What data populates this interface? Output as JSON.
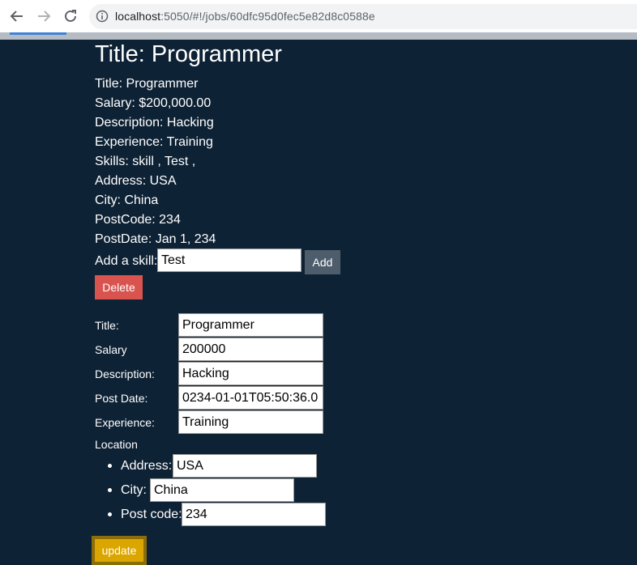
{
  "browser": {
    "url_host": "localhost",
    "url_rest": ":5050/#!/jobs/60dfc95d0fec5e82d8c0588e"
  },
  "job": {
    "heading": "Title: Programmer",
    "title_line": "Title: Programmer",
    "salary_line": "Salary: $200,000.00",
    "description_line": "Description: Hacking",
    "experience_line": "Experience: Training",
    "skills_line": "Skills: skill , Test ,",
    "address_line": "Address: USA",
    "city_line": "City: China",
    "postcode_line": "PostCode: 234",
    "postdate_line": "PostDate: Jan 1, 234"
  },
  "skill_form": {
    "label": "Add a skill:",
    "value": "Test",
    "add_label": "Add"
  },
  "delete_label": "Delete",
  "edit_form": {
    "title_label": "Title:",
    "title_value": "Programmer",
    "salary_label": "Salary",
    "salary_value": "200000",
    "description_label": "Description:",
    "description_value": "Hacking",
    "postdate_label": "Post Date:",
    "postdate_value": "0234-01-01T05:50:36.0",
    "experience_label": "Experience:",
    "experience_value": "Training",
    "location_label": "Location",
    "address_label": "Address:",
    "address_value": "USA",
    "city_label": "City:",
    "city_value": "China",
    "postcode_label": "Post code:",
    "postcode_value": "234",
    "update_label": "update"
  },
  "colors": {
    "background": "#0e2235",
    "add_button": "#4e5d6c",
    "delete_button": "#d9534f",
    "update_button": "#dca600"
  }
}
